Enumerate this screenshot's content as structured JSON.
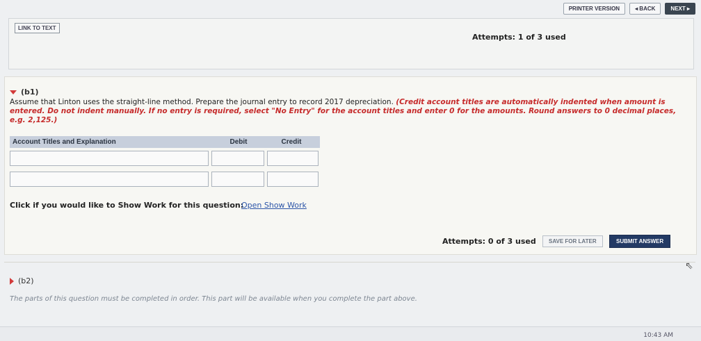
{
  "nav": {
    "printer": "PRINTER VERSION",
    "back": "◂ BACK",
    "next": "NEXT ▸"
  },
  "link_to_text": "LINK TO TEXT",
  "attempts_top": "Attempts: 1 of 3 used",
  "b1": {
    "header": "(b1)",
    "instruction_plain": "Assume that Linton uses the straight-line method. Prepare the journal entry to record 2017 depreciation. ",
    "instruction_red": "(Credit account titles are automatically indented when amount is entered. Do not indent manually. If no entry is required, select \"No Entry\" for the account titles and enter 0 for the amounts. Round answers to 0 decimal places, e.g. 2,125.)"
  },
  "journal": {
    "headers": [
      "Account Titles and Explanation",
      "Debit",
      "Credit"
    ]
  },
  "show_work": {
    "label": "Click if you would like to Show Work for this question:",
    "link": "Open Show Work"
  },
  "attempts_bottom": "Attempts: 0 of 3 used",
  "buttons": {
    "save": "SAVE FOR LATER",
    "submit": "SUBMIT ANSWER"
  },
  "b2": {
    "header": "(b2)",
    "note": "The parts of this question must be completed in order. This part will be available when you complete the part above."
  },
  "clock": "10:43 AM"
}
